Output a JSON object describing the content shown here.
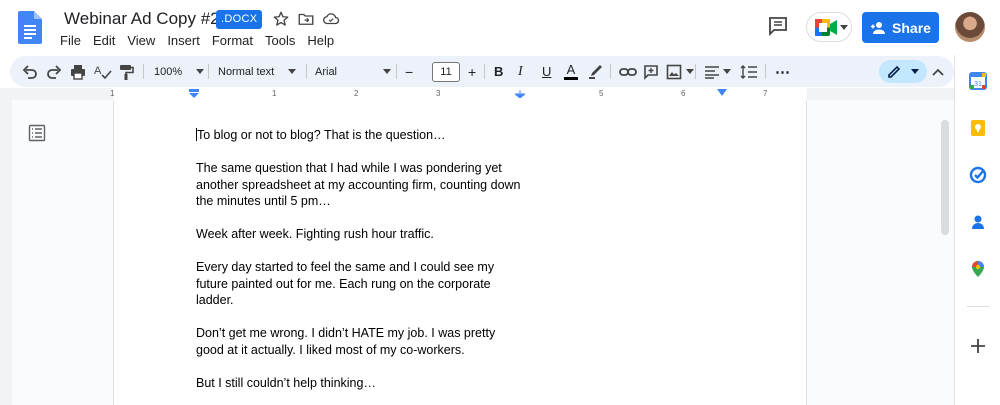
{
  "header": {
    "title": "Webinar Ad Copy #2",
    "badge": ".DOCX",
    "menu": [
      "File",
      "Edit",
      "View",
      "Insert",
      "Format",
      "Tools",
      "Help"
    ],
    "share_label": "Share"
  },
  "toolbar": {
    "zoom": "100%",
    "style": "Normal text",
    "font": "Arial",
    "font_size": "11",
    "minus": "−",
    "plus": "+",
    "bold": "B",
    "italic": "I",
    "underline": "U",
    "text_color": "A",
    "more": "⋯"
  },
  "ruler": {
    "labels": [
      "1",
      "1",
      "2",
      "3",
      "4",
      "5",
      "6",
      "7"
    ]
  },
  "document": {
    "paragraphs": [
      "To blog or not to blog? That is the question…",
      "The same question that I had while I was pondering yet\nanother spreadsheet at my accounting firm, counting down\nthe minutes until 5 pm…",
      "Week after week. Fighting rush hour traffic.",
      "Every day started to feel the same and I could see my\nfuture painted out for me. Each rung on the corporate\nladder.",
      "Don’t get me wrong. I didn’t HATE my job. I was pretty\ngood at it actually. I liked most of my co-workers.",
      "But I still couldn’t help thinking…"
    ]
  },
  "colors": {
    "accent": "#1a73e8",
    "toolbar_bg": "#edf2fa",
    "edit_mode_bg": "#c2e7ff"
  },
  "icons": [
    "docs-logo-icon",
    "star-icon",
    "move-folder-icon",
    "cloud-status-icon",
    "comment-icon",
    "meet-icon",
    "undo-icon",
    "redo-icon",
    "print-icon",
    "spellcheck-icon",
    "paint-format-icon",
    "link-icon",
    "add-comment-icon",
    "image-icon",
    "align-icon",
    "line-spacing-icon",
    "pencil-icon",
    "collapse-icon",
    "calendar-icon",
    "keep-icon",
    "tasks-icon",
    "contacts-icon",
    "maps-icon",
    "add-icon",
    "outline-icon"
  ]
}
